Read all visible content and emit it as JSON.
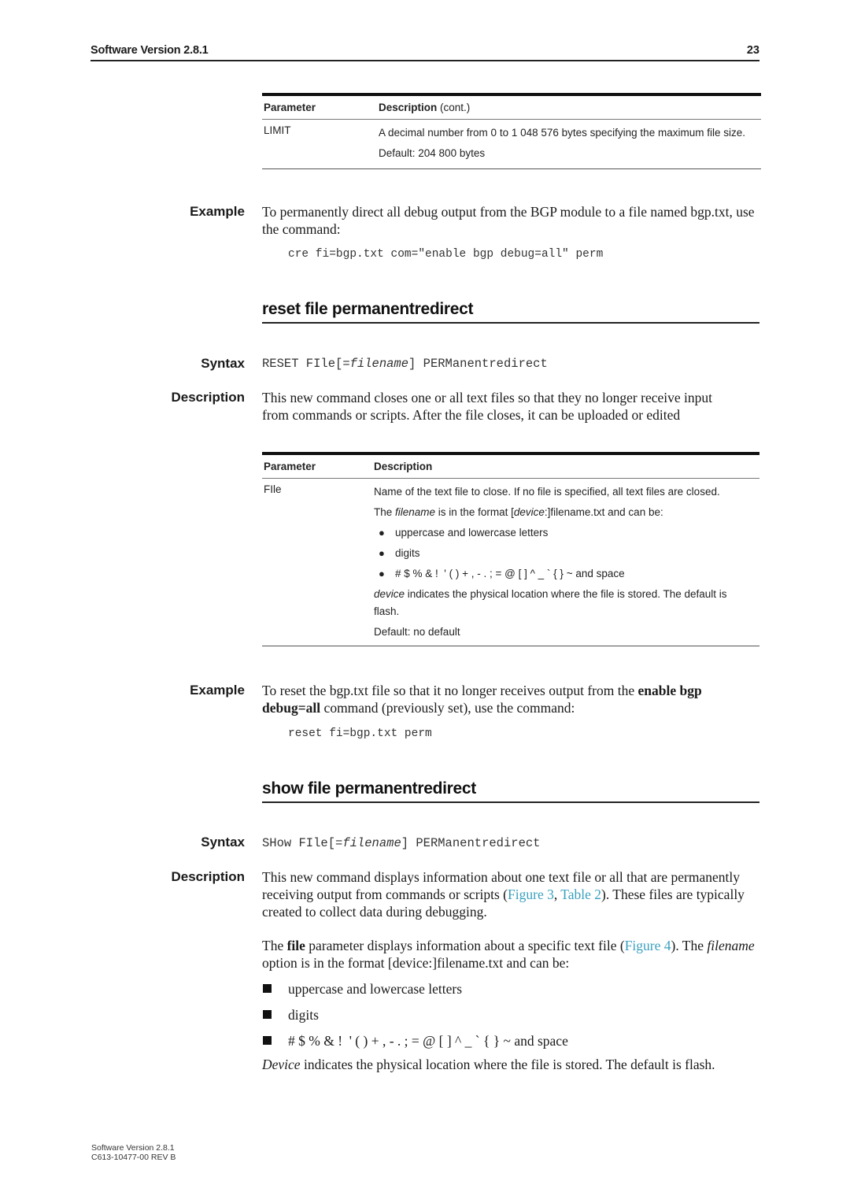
{
  "header": {
    "title": "Software Version 2.8.1",
    "page_number": "23"
  },
  "limit_table": {
    "col_parameter": "Parameter",
    "col_description": "Description",
    "col_description_suffix": "(cont.)",
    "rows": [
      {
        "parameter": "LIMIT",
        "description": "A decimal number from 0 to 1 048 576 bytes specifying the maximum file size.",
        "default": "Default: 204 800 bytes"
      }
    ]
  },
  "create_example": {
    "label": "Example",
    "text": "To permanently direct all debug output from the BGP module to a file named bgp.txt, use the command:",
    "command": "cre fi=bgp.txt com=\"enable bgp debug=all\" perm"
  },
  "reset_section": {
    "heading": "reset file permanentredirect",
    "syntax_label": "Syntax",
    "syntax_prefix": "RESET FIle[=",
    "syntax_italic": "filename",
    "syntax_suffix": "] PERManentredirect",
    "description_label": "Description",
    "description": "This new command closes one or all text files so that they no longer receive input from commands or scripts. After the file closes, it can be uploaded or edited",
    "table": {
      "col_parameter": "Parameter",
      "col_description": "Description",
      "rows": [
        {
          "parameter": "FIle",
          "line1": "Name of the text file to close. If no file is specified, all text files are closed.",
          "format_pre": "The ",
          "format_italic1": "filename",
          "format_mid": " is in the format [",
          "format_italic2": "device",
          "format_post": ":]filename.txt and can be:",
          "bullets": [
            "uppercase and lowercase letters",
            "digits",
            "# $ % & !  ' ( ) + , - . ; = @ [ ] ^ _ ` { } ~ and space"
          ],
          "device_italic": "device",
          "device_text": " indicates the physical location where the file is stored. The default is flash.",
          "default": "Default: no default"
        }
      ]
    },
    "example_label": "Example",
    "example_pre": "To reset the bgp.txt file so that it no longer receives output from the ",
    "example_bold": "enable bgp debug=all",
    "example_post": " command (previously set), use the command:",
    "example_command": "reset fi=bgp.txt perm"
  },
  "show_section": {
    "heading": "show file permanentredirect",
    "syntax_label": "Syntax",
    "syntax_prefix": "SHow FIle[=",
    "syntax_italic": "filename",
    "syntax_suffix": "] PERManentredirect",
    "description_label": "Description",
    "desc1_pre": "This new command displays information about one text file or all that are permanently receiving output from commands or scripts (",
    "desc1_link1": "Figure 3",
    "desc1_sep": ", ",
    "desc1_link2": "Table 2",
    "desc1_post": "). These files are typically created to collect data during debugging.",
    "desc2_pre": "The ",
    "desc2_bold": "file",
    "desc2_mid": " parameter displays information about a specific text file (",
    "desc2_link": "Figure 4",
    "desc2_mid2": "). The ",
    "desc2_italic": "filename",
    "desc2_post": " option is in the format [device:]filename.txt and can be:",
    "bullets": [
      "uppercase and lowercase letters",
      "digits",
      "# $ % & !  ' ( ) + , - . ; = @ [ ] ^ _ ` { } ~ and space"
    ],
    "device_italic": "Device",
    "device_text": " indicates the physical location where the file is stored. The default is flash."
  },
  "footer": {
    "line1": "Software Version 2.8.1",
    "line2": "C613-10477-00 REV B"
  },
  "colors": {
    "link": "#3aa0bf",
    "text": "#1a1a1a"
  }
}
